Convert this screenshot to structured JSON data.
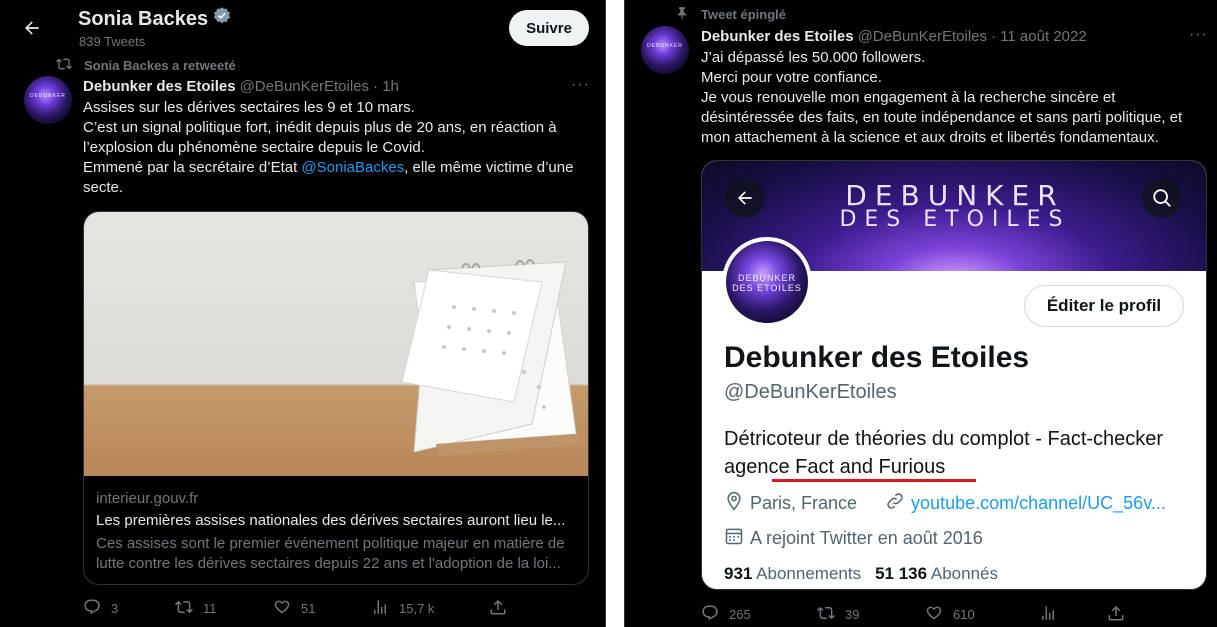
{
  "left": {
    "header": {
      "name": "Sonia Backes",
      "tweet_count": "839 Tweets",
      "follow_label": "Suivre"
    },
    "retweet_label": "Sonia Backes a retweeté",
    "tweet": {
      "name": "Debunker des Etoiles",
      "handle": "@DeBunKerEtoiles",
      "time": "· 1h",
      "lines": [
        "Assises sur les dérives sectaires les 9 et 10 mars.",
        "C’est un signal politique fort, inédit depuis plus de 20 ans, en réaction à",
        "l’explosion du phénomène sectaire depuis le Covid.",
        "Emmené par la secrétaire d’Etat ",
        "@SoniaBackes",
        ", elle même victime d’une",
        "secte."
      ],
      "card": {
        "domain": "interieur.gouv.fr",
        "title": "Les premières assises nationales des dérives sectaires auront lieu le...",
        "desc": "Ces assises sont le premier événement politique majeur en matière de lutte contre les dérives sectaires depuis 22 ans et l'adoption de la loi..."
      },
      "actions": {
        "replies": "3",
        "retweets": "11",
        "likes": "51",
        "views": "15,7 k"
      }
    }
  },
  "right": {
    "pinned_label": "Tweet épinglé",
    "tweet": {
      "name": "Debunker des Etoiles",
      "handle": "@DeBunKerEtoiles",
      "time": "· 11 août 2022",
      "lines": [
        "J’ai dépassé les 50.000 followers.",
        "Merci pour votre confiance.",
        "Je vous renouvelle mon engagement à la recherche sincère et",
        "désintéressée des faits, en toute indépendance et sans parti politique, et",
        "mon attachement à la science et aux droits et libertés fondamentaux."
      ],
      "embed": {
        "banner_line1": "DEBUNKER",
        "banner_line2": "DES ETOILES",
        "avatar_text": "DEBUNKER DES ETOILES",
        "edit_label": "Éditer le profil",
        "name": "Debunker des Etoiles",
        "handle": "@DeBunKerEtoiles",
        "bio_line1": "Détricoteur de théories du complot - Fact-checker",
        "bio_line2": "agence Fact and Furious",
        "location": "Paris, France",
        "link": "youtube.com/channel/UC_56v...",
        "joined": "A rejoint Twitter en août 2016",
        "following_count": "931",
        "following_label": "Abonnements",
        "followers_count": "51 136",
        "followers_label": "Abonnés"
      },
      "actions": {
        "replies": "265",
        "retweets": "39",
        "likes": "610"
      }
    }
  },
  "colors": {
    "accent": "#1d9bf0",
    "muted": "#71767b",
    "underline": "#e0161b"
  }
}
